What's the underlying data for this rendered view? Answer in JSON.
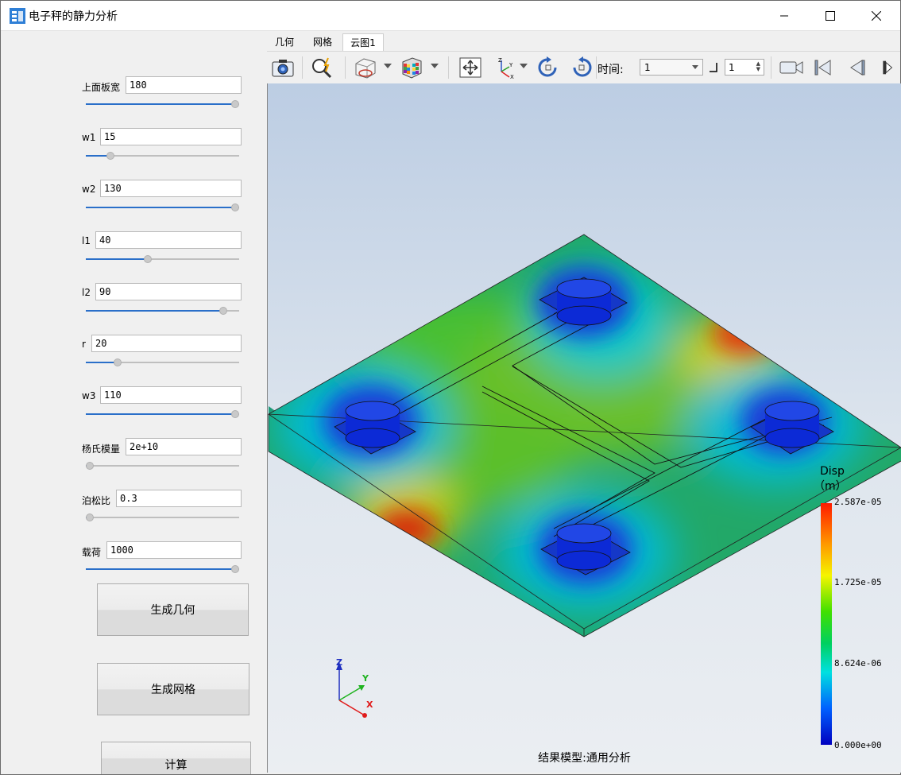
{
  "window": {
    "title": "电子秤的静力分析"
  },
  "params": [
    {
      "label": "上面板宽",
      "value": "180",
      "slider": 1.0
    },
    {
      "label": "w1",
      "value": "15",
      "slider": 0.14
    },
    {
      "label": "w2",
      "value": "130",
      "slider": 1.0
    },
    {
      "label": "l1",
      "value": "40",
      "slider": 0.4
    },
    {
      "label": "l2",
      "value": "90",
      "slider": 0.92
    },
    {
      "label": "r",
      "value": "20",
      "slider": 0.19
    },
    {
      "label": "w3",
      "value": "110",
      "slider": 1.0
    },
    {
      "label": "杨氏模量",
      "value": "2e+10",
      "slider": 0.0
    },
    {
      "label": "泊松比",
      "value": "0.3",
      "slider": 0.0
    },
    {
      "label": "载荷",
      "value": "1000",
      "slider": 1.0
    }
  ],
  "buttons": {
    "gen_geometry": "生成几何",
    "gen_mesh": "生成网格",
    "compute": "计算"
  },
  "tabs": [
    "几何",
    "网格",
    "云图1"
  ],
  "active_tab": "云图1",
  "toolbar": {
    "time_label": "时间:",
    "time_value": "1",
    "step_value": "1"
  },
  "legend": {
    "title": "Disp",
    "unit": "（m）",
    "ticks": [
      "2.587e-05",
      "1.725e-05",
      "8.624e-06",
      "0.000e+00"
    ]
  },
  "axes": {
    "z": "Z",
    "y": "Y",
    "x": "X"
  },
  "caption": "结果模型:通用分析",
  "colors": {
    "accent": "#2a6fc9",
    "viewport_top": "#bccde3",
    "plate_base": "#23a66b"
  },
  "icons": [
    "app-icon",
    "minimize-icon",
    "maximize-icon",
    "close-icon",
    "camera-icon",
    "zoom-icon",
    "view-box-icon",
    "color-cube-icon",
    "fit-view-icon",
    "axes-icon",
    "rotate-left-icon",
    "rotate-right-icon",
    "record-icon",
    "first-frame-icon",
    "prev-frame-icon",
    "next-frame-icon"
  ]
}
